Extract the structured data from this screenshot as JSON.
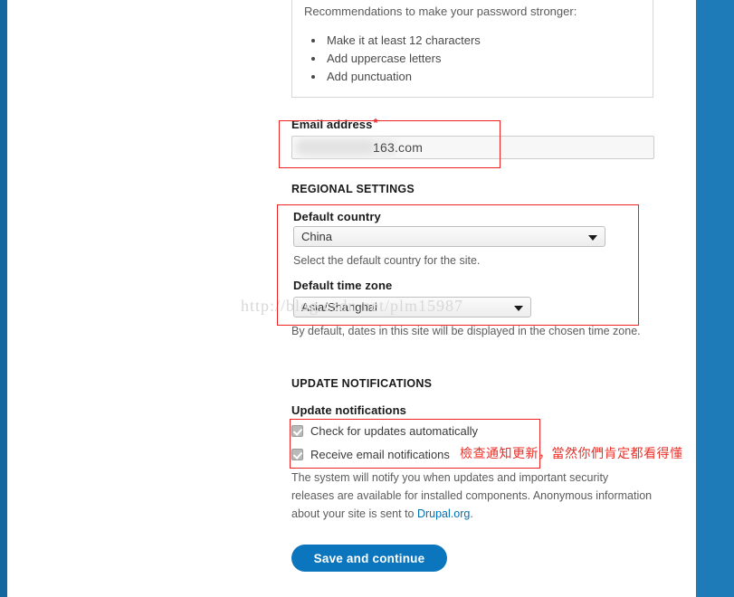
{
  "theme": {
    "accent_blue": "#0b76bd",
    "edge_stripe": "#15689f",
    "edge_band": "#1f7ab8",
    "annotation_red": "#ee2222",
    "link_blue": "#0071b3"
  },
  "password_recommendations": {
    "title": "Recommendations to make your password stronger:",
    "items": [
      "Make it at least 12 characters",
      "Add uppercase letters",
      "Add punctuation"
    ]
  },
  "email": {
    "label": "Email address",
    "required_marker": "*",
    "value_visible_tail": "163.com",
    "placeholder": ""
  },
  "regional_settings": {
    "heading": "REGIONAL SETTINGS",
    "country": {
      "label": "Default country",
      "value": "China",
      "help": "Select the default country for the site."
    },
    "timezone": {
      "label": "Default time zone",
      "value": "Asia/Shanghai",
      "help": "By default, dates in this site will be displayed in the chosen time zone."
    }
  },
  "update_notifications": {
    "heading": "UPDATE NOTIFICATIONS",
    "label": "Update notifications",
    "checkboxes": [
      {
        "label": "Check for updates automatically",
        "checked": true
      },
      {
        "label": "Receive email notifications",
        "checked": true
      }
    ],
    "help_before_link": "The system will notify you when updates and important security releases are available for installed components. Anonymous information about your site is sent to ",
    "help_link": "Drupal.org",
    "help_after_link": "."
  },
  "actions": {
    "submit_label": "Save and continue"
  },
  "annotations": {
    "chinese_note": "檢查通知更新，當然你們肯定都看得懂"
  },
  "watermark": {
    "text": "http://blog.csdn.net/plm15987"
  }
}
